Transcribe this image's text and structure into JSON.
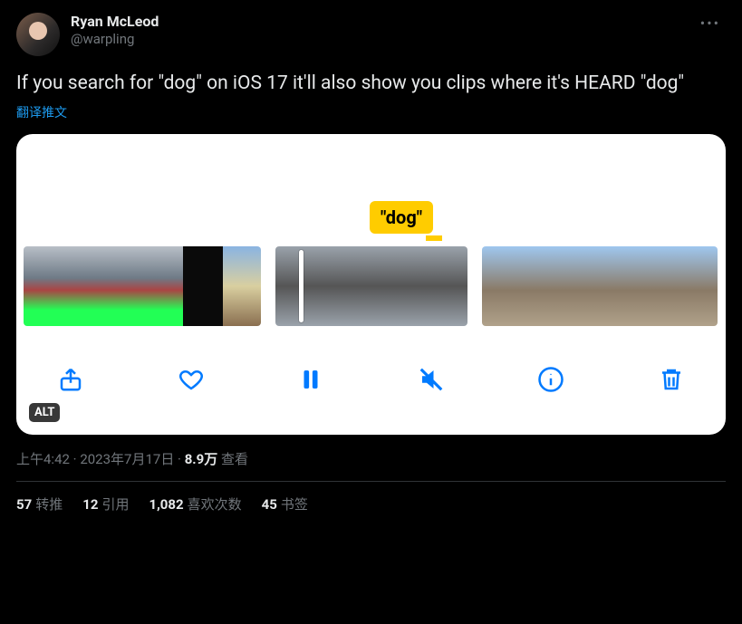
{
  "author": {
    "display_name": "Ryan McLeod",
    "handle": "@warpling"
  },
  "body_text": "If you search for \"dog\" on iOS 17 it'll also show you clips where it's HEARD \"dog\"",
  "translate_label": "翻译推文",
  "media": {
    "tooltip_text": "\"dog\"",
    "alt_badge": "ALT",
    "toolbar": {
      "share": "share",
      "favorite": "favorite",
      "pause": "pause",
      "mute": "mute",
      "info": "info",
      "trash": "trash"
    }
  },
  "meta": {
    "time": "上午4:42",
    "date": "2023年7月17日",
    "separator": " · ",
    "views_number": "8.9万",
    "views_label": " 查看"
  },
  "stats": {
    "retweets": {
      "count": "57",
      "label": "转推"
    },
    "quotes": {
      "count": "12",
      "label": "引用"
    },
    "likes": {
      "count": "1,082",
      "label": "喜欢次数"
    },
    "bookmarks": {
      "count": "45",
      "label": "书签"
    }
  },
  "more_glyph": "•••"
}
